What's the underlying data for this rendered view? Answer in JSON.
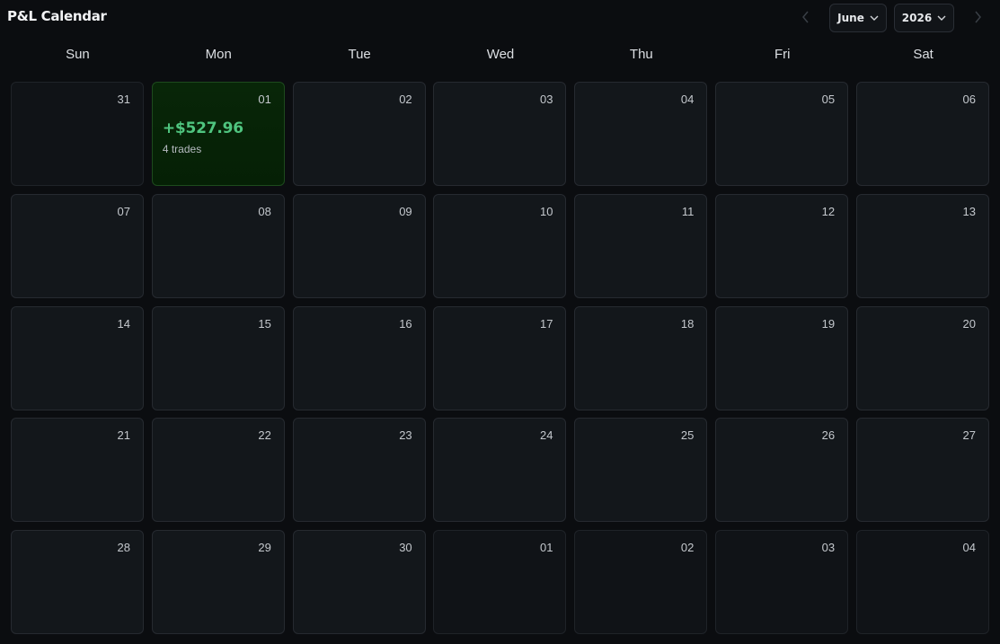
{
  "header": {
    "title": "P&L Calendar",
    "month_select": "June",
    "year_select": "2026",
    "prev_icon": "chevron-left-icon",
    "next_icon": "chevron-right-icon",
    "dropdown_icon": "chevron-down-icon"
  },
  "weekdays": [
    "Sun",
    "Mon",
    "Tue",
    "Wed",
    "Thu",
    "Fri",
    "Sat"
  ],
  "colors": {
    "profit": "#4fc57f",
    "profit_cell_bg": "#062306",
    "cell_bg": "#13171b",
    "page_bg": "#0b0d10"
  },
  "days": [
    {
      "day": "31",
      "outside": true
    },
    {
      "day": "01",
      "pnl": "+$527.96",
      "trades": "4 trades",
      "status": "profit"
    },
    {
      "day": "02"
    },
    {
      "day": "03"
    },
    {
      "day": "04"
    },
    {
      "day": "05"
    },
    {
      "day": "06"
    },
    {
      "day": "07"
    },
    {
      "day": "08"
    },
    {
      "day": "09"
    },
    {
      "day": "10"
    },
    {
      "day": "11"
    },
    {
      "day": "12"
    },
    {
      "day": "13"
    },
    {
      "day": "14"
    },
    {
      "day": "15"
    },
    {
      "day": "16"
    },
    {
      "day": "17"
    },
    {
      "day": "18"
    },
    {
      "day": "19"
    },
    {
      "day": "20"
    },
    {
      "day": "21"
    },
    {
      "day": "22"
    },
    {
      "day": "23"
    },
    {
      "day": "24"
    },
    {
      "day": "25"
    },
    {
      "day": "26"
    },
    {
      "day": "27"
    },
    {
      "day": "28"
    },
    {
      "day": "29"
    },
    {
      "day": "30"
    },
    {
      "day": "01",
      "outside": true
    },
    {
      "day": "02",
      "outside": true
    },
    {
      "day": "03",
      "outside": true
    },
    {
      "day": "04",
      "outside": true
    }
  ]
}
